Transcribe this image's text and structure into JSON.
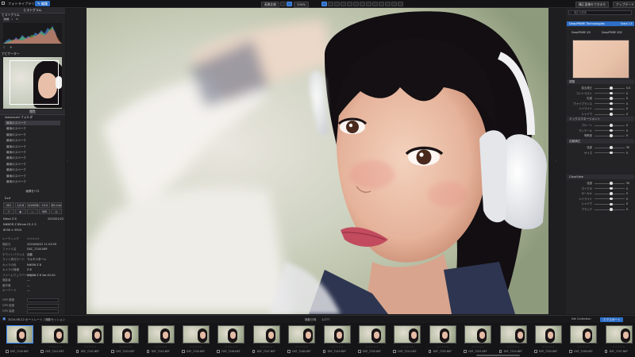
{
  "topbar": {
    "tabs": [
      "フォトライブラリ",
      "編集"
    ],
    "view_label": "画像比較",
    "zoom_label": "100%",
    "right_buttons": [
      "構正面像をできるモ",
      "アップデート"
    ]
  },
  "left": {
    "header": "ヒストグラム",
    "histogram_label": "ヒストグラム",
    "hist_tabs": [
      "RGB",
      "L",
      "R"
    ],
    "navigator_label": "ナビゲーター",
    "browse_label": "閲覧",
    "albums_head": "Advanced フォルダ",
    "album_items": [
      "最後のスペーク",
      "最後のスペーク",
      "最後のスペーク",
      "最後のスペーク",
      "最後のスペーク",
      "最後のスペーク",
      "最後のスペーク",
      "最後のスペーク",
      "最後のスペーク",
      "最後のスペーク",
      "最後のスペーク"
    ],
    "add_button": "画像をドロ",
    "exif_label": "Exif",
    "exif_buttons": [
      "ISO 100",
      "1/2.8",
      "1/1600s",
      "+0.0 EV",
      "85 mm"
    ],
    "camera_line1": "Nikon Z 8",
    "camera_line2": "NIKKOR Z 85mm f/1.2 S",
    "date_value": "2023/01/22",
    "size_value": "8256 × 5504",
    "meta": [
      {
        "k": "レーティング",
        "v": "☆☆☆☆☆"
      },
      {
        "k": "撮影日",
        "v": "2024/06/22 11:23:59"
      },
      {
        "k": "ファイル名",
        "v": "DSC_7245.NEF"
      },
      {
        "k": "ホワイトバランス",
        "v": "自動"
      },
      {
        "k": "ライト測光モード",
        "v": "マルチパターン"
      },
      {
        "k": "カメラの色",
        "v": "NIKON Z 8"
      },
      {
        "k": "カメラの機種",
        "v": "Z 8"
      },
      {
        "k": "ファームウェアバージョン",
        "v": "NIKON Z 8 Ver.02.00"
      },
      {
        "k": "撮影者",
        "v": "—"
      },
      {
        "k": "著作権",
        "v": "—"
      },
      {
        "k": "キーワード",
        "v": "—"
      }
    ],
    "gps": [
      {
        "k": "GPS 緯度",
        "v": ""
      },
      {
        "k": "GPS 経度",
        "v": ""
      },
      {
        "k": "GPS 高度",
        "v": ""
      }
    ]
  },
  "right": {
    "search_placeholder": "補正を検索",
    "tool_title": "DeepPRIME Technologies",
    "tool_value": "Extra 1.5",
    "options": [
      "DeepPRIME XD",
      "DeepPRIME XD2"
    ],
    "section1": "調整",
    "sliders1": [
      {
        "label": "露出補正",
        "value": "0.0"
      },
      {
        "label": "コントラスト",
        "value": "0"
      },
      {
        "label": "彩度",
        "value": "0"
      },
      {
        "label": "ヴァイブランス",
        "value": "0"
      },
      {
        "label": "ハイライト",
        "value": "0"
      },
      {
        "label": "シャドウ",
        "value": "0"
      }
    ],
    "section2": "ミックスマネージメント",
    "sliders2": [
      {
        "label": "ブルーン",
        "value": "0"
      },
      {
        "label": "ディテール",
        "value": "0"
      },
      {
        "label": "明瞭度",
        "value": "0"
      }
    ],
    "section3": "自動補正",
    "sliders3": [
      {
        "label": "強度",
        "value": "50"
      },
      {
        "label": "サイズ",
        "value": "0"
      }
    ],
    "section4": "ClearView",
    "sliders4": [
      {
        "label": "強度",
        "value": "50"
      },
      {
        "label": "マイクロ",
        "value": "0"
      },
      {
        "label": "ローカル",
        "value": "0"
      },
      {
        "label": "ハイライト",
        "value": "0"
      },
      {
        "label": "シャドウ",
        "value": "0"
      },
      {
        "label": "ブラック",
        "value": "0"
      }
    ]
  },
  "filmstrip": {
    "path": "2024-06-22 ポートレート / 撮影セッション",
    "sort_label": "撮影日時",
    "count": "1/277",
    "right_label": "Nik Collection",
    "export_button": "エクスポート",
    "files": [
      "DSF_7240.NEF",
      "DSF_7241.NEF",
      "DSF_7242.NEF",
      "DSF_7243.NEF",
      "DSF_7244.NEF",
      "DSF_7245.NEF",
      "DSF_7246.NEF",
      "DSF_7247.NEF",
      "DSF_7248.NEF",
      "DSF_7249.NEF",
      "DSF_7250.NEF",
      "DSF_7251.NEF",
      "DSF_7252.NEF",
      "DSF_7253.NEF",
      "DSF_7254.NEF",
      "DSF_7255.NEF",
      "DSF_7256.NEF",
      "DSF_7257.NEF"
    ],
    "stars": "☆☆☆☆☆"
  },
  "colors": {
    "accent": "#2d6ec7",
    "panel": "#232326",
    "bg": "#1b1b1d"
  }
}
